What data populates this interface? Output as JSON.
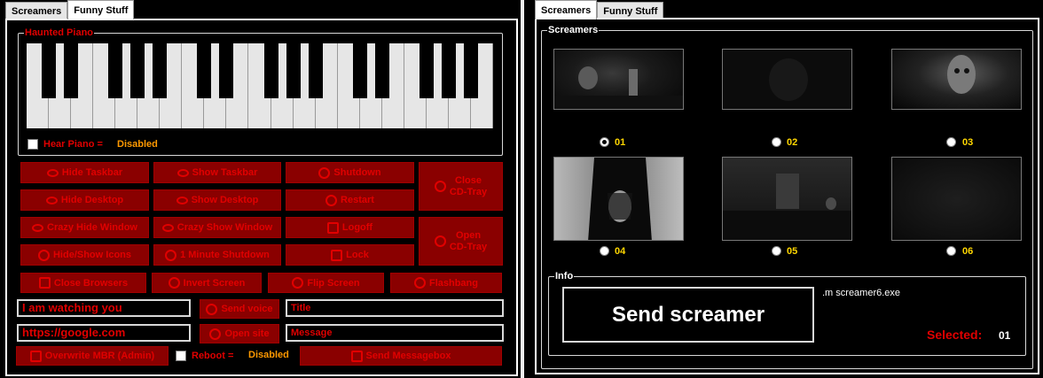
{
  "left": {
    "tabs": [
      "Screamers",
      "Funny Stuff"
    ],
    "piano": {
      "legend": "Haunted Piano",
      "hear_label": "Hear Piano =",
      "hear_status": "Disabled"
    },
    "buttons": {
      "hide_taskbar": "Hide Taskbar",
      "show_taskbar": "Show Taskbar",
      "shutdown": "Shutdown",
      "close_cd": "Close\nCD-Tray",
      "hide_desktop": "Hide Desktop",
      "show_desktop": "Show Desktop",
      "restart": "Restart",
      "crazy_hide": "Crazy Hide Window",
      "crazy_show": "Crazy Show Window",
      "logoff": "Logoff",
      "open_cd": "Open\nCD-Tray",
      "hide_show_icons": "Hide/Show Icons",
      "minute_shutdown": "1 Minute Shutdown",
      "lock": "Lock",
      "close_browsers": "Close Browsers",
      "invert_screen": "Invert Screen",
      "flip_screen": "Flip Screen",
      "flashbang": "Flashbang",
      "send_voice": "Send voice",
      "open_site": "Open site",
      "overwrite_mbr": "Overwrite MBR (Admin)",
      "send_messagebox": "Send Messagebox"
    },
    "inputs": {
      "voice_text": "I am watching you",
      "site_url": "https://google.com",
      "title": "Title",
      "message": "Message"
    },
    "reboot_label": "Reboot =",
    "reboot_status": "Disabled"
  },
  "right": {
    "tabs": [
      "Screamers",
      "Funny Stuff"
    ],
    "screamers_legend": "Screamers",
    "options": [
      {
        "num": "01",
        "selected": true
      },
      {
        "num": "02",
        "selected": false
      },
      {
        "num": "03",
        "selected": false
      },
      {
        "num": "04",
        "selected": false
      },
      {
        "num": "05",
        "selected": false
      },
      {
        "num": "06",
        "selected": false
      }
    ],
    "info": {
      "legend": "Info",
      "send_button": "Send screamer",
      "file": ".m screamer6.exe",
      "selected_label": "Selected:",
      "selected_value": "01"
    }
  },
  "colors": {
    "accent_red": "#e00000",
    "button_bg": "#8a0000",
    "status_orange": "#ff9900",
    "number_yellow": "#ffd700"
  }
}
